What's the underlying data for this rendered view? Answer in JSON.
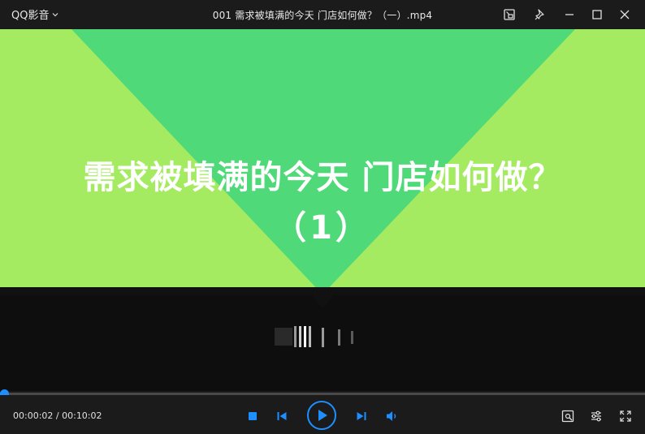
{
  "app": {
    "name": "QQ影音"
  },
  "window": {
    "title": "001 需求被填满的今天 门店如何做？（一）.mp4"
  },
  "video": {
    "title_line1": "需求被填满的今天 门店如何做？",
    "title_line2": "（1）",
    "colors": {
      "outer": "#a4eb62",
      "inner": "#4fd978",
      "dark": "#0e0e0e"
    }
  },
  "playback": {
    "current_time": "00:00:02",
    "separator": " / ",
    "total_time": "00:10:02",
    "progress": 0.0033
  },
  "icons": {
    "titlebar": [
      "app-menu-chevron-icon",
      "picture-in-picture-icon",
      "pin-icon",
      "minimize-icon",
      "maximize-icon",
      "close-icon"
    ],
    "controls": [
      "stop-icon",
      "previous-icon",
      "play-icon",
      "next-icon",
      "volume-icon",
      "screenshot-icon",
      "settings-icon",
      "fullscreen-icon"
    ]
  },
  "accent_color": "#1e8fff"
}
